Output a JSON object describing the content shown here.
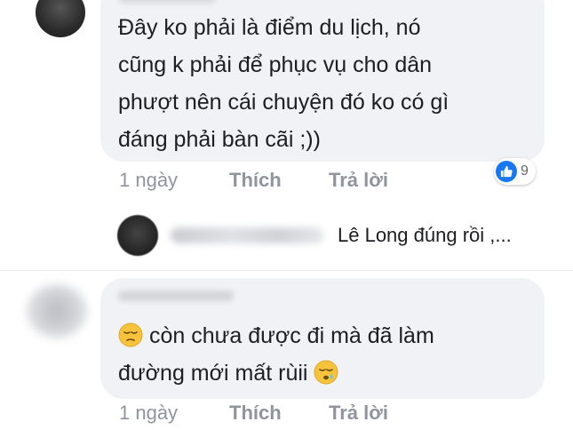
{
  "comments": [
    {
      "text": "Đây ko phải là điểm du lịch, nó\ncũng k phải để phục vụ cho dân\nphượt nên cái chuyện đó ko có gì\nđáng phải bàn cãi ;))",
      "time": "1 ngày",
      "like_label": "Thích",
      "reply_label": "Trả lời",
      "reaction": {
        "icon": "thumbs-up-icon",
        "count": "9",
        "color": "#1877f2"
      }
    },
    {
      "text_line1": "còn chưa được đi mà đã làm",
      "text_line2": "đường mới mất rùii",
      "emoji_start": "pensive-face-icon",
      "emoji_end": "sleepy-face-icon",
      "time": "1 ngày",
      "like_label": "Thích",
      "reply_label": "Trả lời"
    }
  ],
  "reply_preview": {
    "text": "Lê Long đúng rồi ,..."
  },
  "colors": {
    "bubble": "#f1f2f5",
    "text": "#1c1e21",
    "meta": "#90949c",
    "accent": "#1877f2"
  }
}
